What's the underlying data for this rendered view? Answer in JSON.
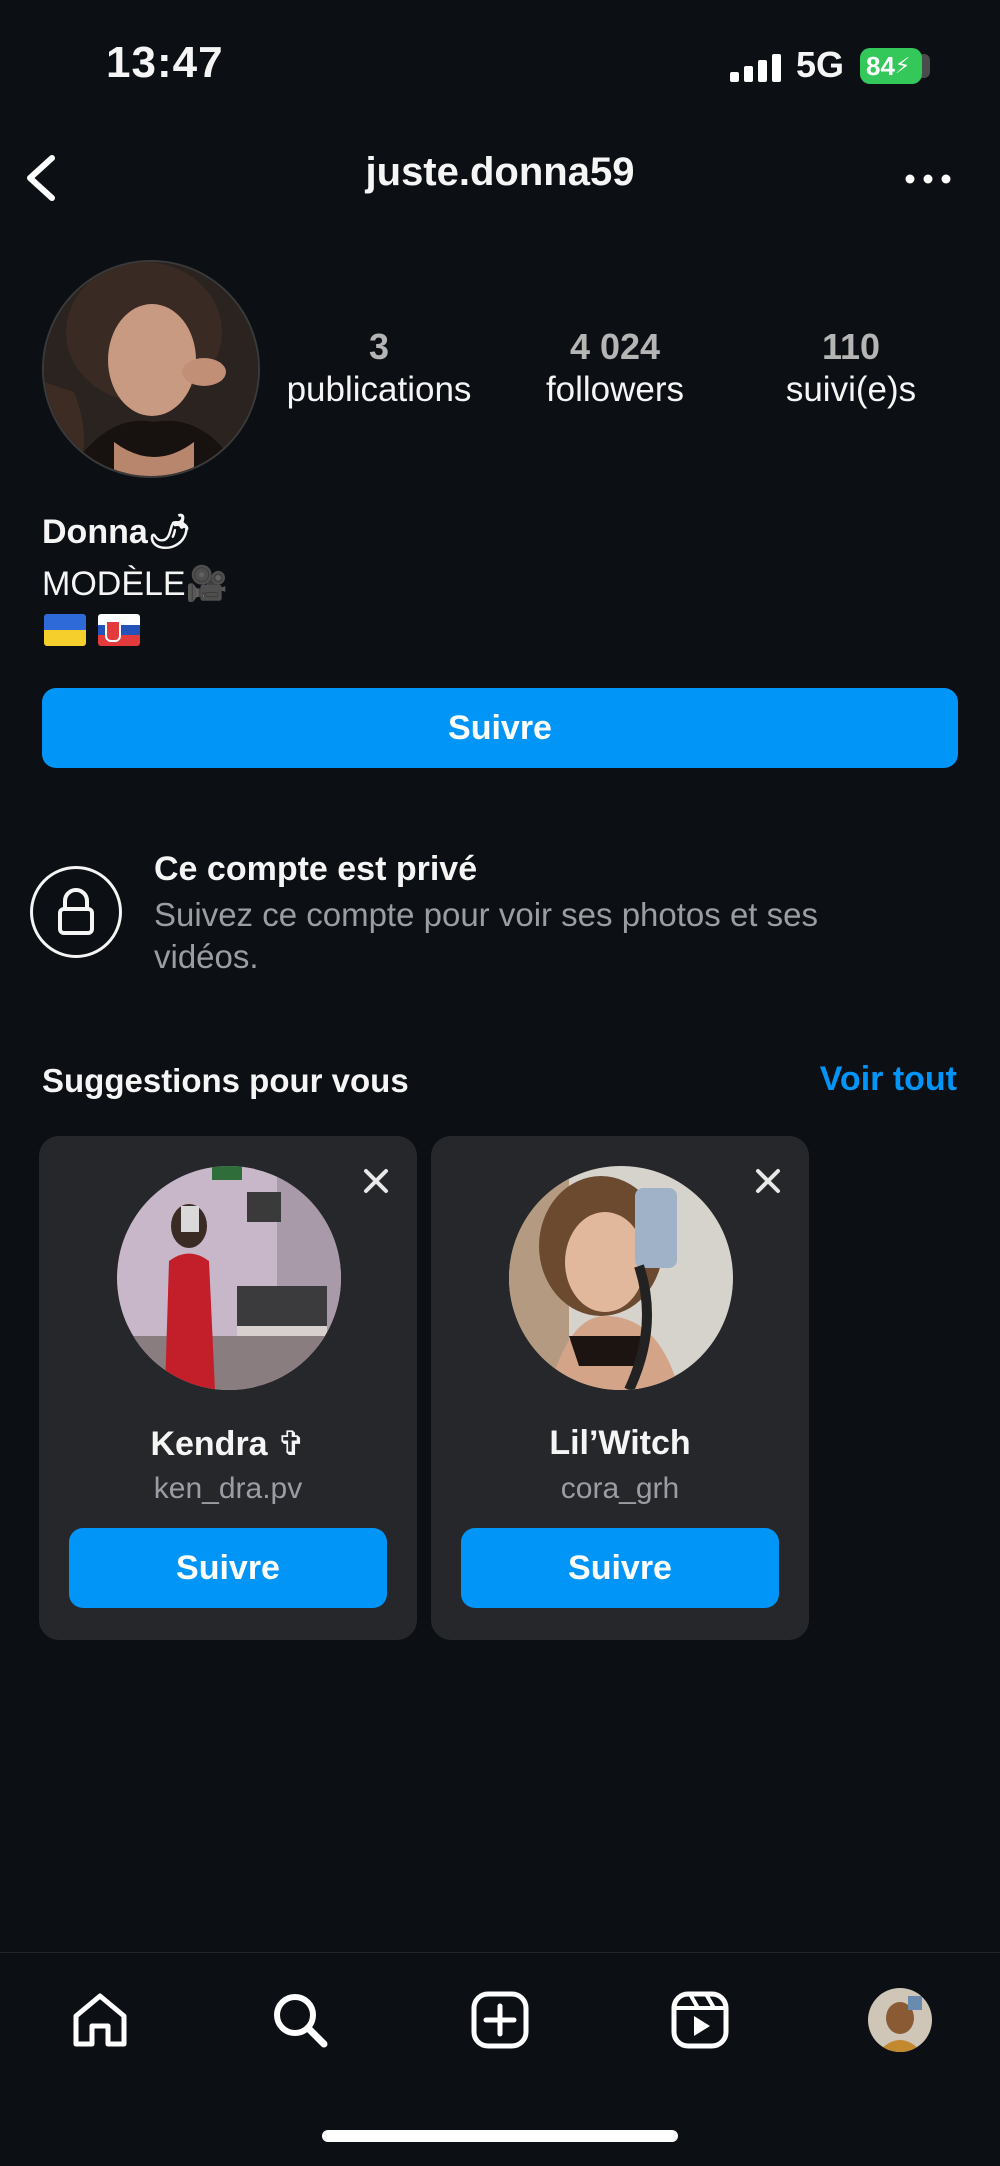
{
  "status_bar": {
    "time": "13:47",
    "network": "5G",
    "battery": "84"
  },
  "header": {
    "username": "juste.donna59"
  },
  "profile": {
    "stats": [
      {
        "value": "3",
        "label": "publications"
      },
      {
        "value": "4 024",
        "label": "followers"
      },
      {
        "value": "110",
        "label": "suivi(e)s"
      }
    ],
    "name": "Donna",
    "bio_line": "MODÈLE",
    "follow_label": "Suivre"
  },
  "private_notice": {
    "title": "Ce compte est privé",
    "description": "Suivez ce compte pour voir ses photos et ses vidéos."
  },
  "suggestions": {
    "title": "Suggestions pour vous",
    "see_all": "Voir tout",
    "cards": [
      {
        "name": "Kendra ✞",
        "handle": "ken_dra.pv",
        "button": "Suivre"
      },
      {
        "name": "Lil’Witch",
        "handle": "cora_grh",
        "button": "Suivre"
      }
    ]
  },
  "tabbar": {
    "items": [
      "home-icon",
      "search-icon",
      "create-icon",
      "reels-icon",
      "profile-avatar"
    ]
  },
  "colors": {
    "accent": "#0095f6",
    "background": "#0c1014",
    "card": "#26272b",
    "battery": "#34c759"
  }
}
